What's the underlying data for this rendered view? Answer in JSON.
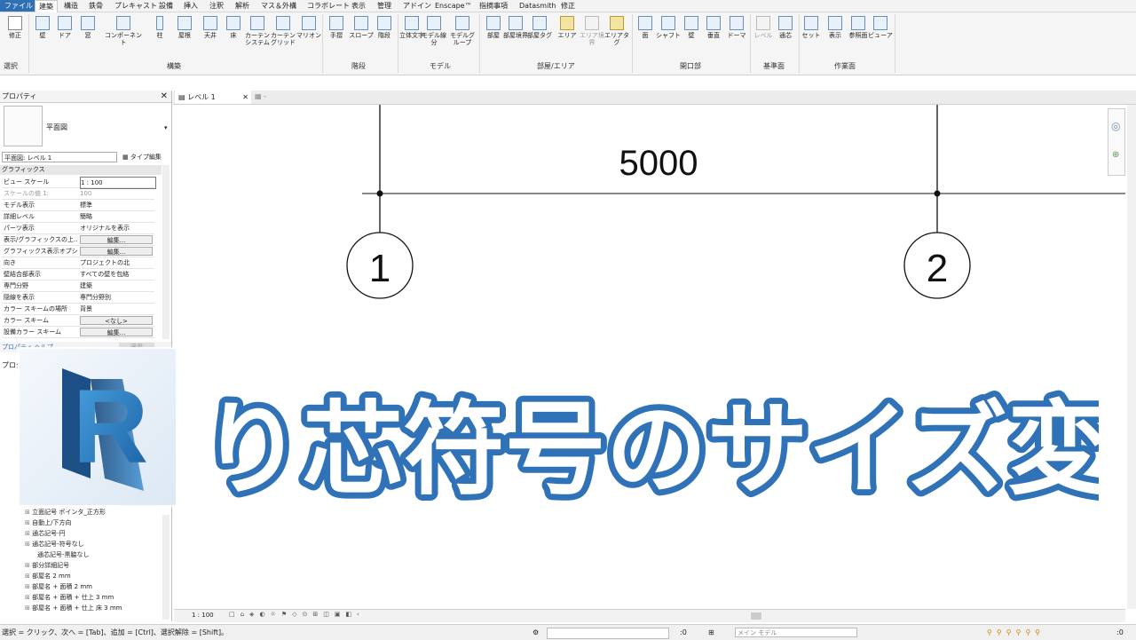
{
  "menu": [
    "ファイル",
    "建築",
    "構造",
    "鉄骨",
    "プレキャスト",
    "設備",
    "挿入",
    "注釈",
    "解析",
    "マス＆外構",
    "コラボレート",
    "表示",
    "管理",
    "アドイン",
    "Enscape™",
    "指摘事項",
    "Datasmith",
    "修正"
  ],
  "ribbon": {
    "tools": [
      "修正",
      "壁",
      "ドア",
      "窓",
      "コンポーネント",
      "柱",
      "屋根",
      "天井",
      "床",
      "カーテンシステム",
      "カーテングリッド",
      "マリオン",
      "手摺",
      "スロープ",
      "階段",
      "立体文字",
      "モデル線分",
      "モデルグループ",
      "部屋",
      "部屋境界",
      "部屋タグ",
      "エリア",
      "エリア境界",
      "エリアタグ",
      "面",
      "シャフト",
      "壁",
      "垂直",
      "ドーマ",
      "レベル",
      "通芯",
      "セット",
      "表示",
      "参照面",
      "ビューア"
    ],
    "panels": [
      "選択",
      "構築",
      "階段",
      "モデル",
      "部屋/エリア",
      "開口部",
      "基準面",
      "作業面"
    ]
  },
  "properties": {
    "title": "プロパティ",
    "type_name": "平面図",
    "selector": "平面図: レベル 1",
    "edit_type": "タイプ編集",
    "section": "グラフィックス",
    "rows": [
      {
        "k": "ビュー スケール",
        "v": "1 : 100"
      },
      {
        "k": "スケールの値    1:",
        "v": "100"
      },
      {
        "k": "モデル表示",
        "v": "標準"
      },
      {
        "k": "詳細レベル",
        "v": "簡略"
      },
      {
        "k": "パーツ表示",
        "v": "オリジナルを表示"
      },
      {
        "k": "表示/グラフィックスの上...",
        "v": "編集..."
      },
      {
        "k": "グラフィックス表示オプシ...",
        "v": "編集..."
      },
      {
        "k": "向き",
        "v": "プロジェクトの北"
      },
      {
        "k": "壁結合部表示",
        "v": "すべての壁を包絡"
      },
      {
        "k": "専門分野",
        "v": "建築"
      },
      {
        "k": "隠線を表示",
        "v": "専門分野別"
      },
      {
        "k": "カラー スキームの場所",
        "v": "背景"
      },
      {
        "k": "カラー スキーム",
        "v": "<なし>"
      },
      {
        "k": "設備カラー スキーム",
        "v": "編集..."
      }
    ],
    "help": "プロパティ ヘルプ",
    "apply": "適用"
  },
  "browser": {
    "title": "プロジェクト",
    "items": [
      "立面記号 ポインタ_正方形",
      "自動上/下方向",
      "通芯記号-円",
      "通芯記号-符号なし",
      "通芯記号-黒脇なし",
      "部分詳細記号",
      "部屋名 2 mm",
      "部屋名 + 面積 2 mm",
      "部屋名 + 面積 + 仕上 3 mm",
      "部屋名 + 面積 + 仕上 床 3 mm"
    ]
  },
  "view": {
    "tab": "レベル 1",
    "dimension": "5000",
    "grid1": "1",
    "grid2": "2",
    "scale": "1 : 100"
  },
  "status": {
    "hint": "選択 = クリック、次へ = [Tab]、追加 = [Ctrl]、選択解除 = [Shift]。",
    "count": ":0",
    "model": "メイン モデル",
    "filter": ":0"
  },
  "overlay": {
    "headline": "通り芯符号のサイズ変更",
    "logo_letter": "R",
    "accent": "#2f72b8"
  }
}
